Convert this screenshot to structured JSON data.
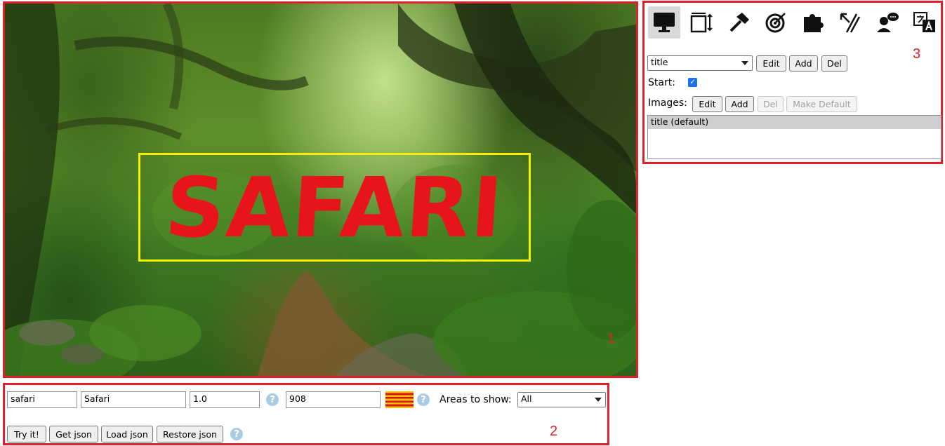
{
  "scene": {
    "title_text": "SAFARI",
    "area_number": "1"
  },
  "toolbar_bottom": {
    "id_value": "safari",
    "name_value": "Safari",
    "version_value": "1.0",
    "width_value": "908",
    "help_icon": "?",
    "areas_label": "Areas to show:",
    "areas_selected": "All",
    "buttons": {
      "try": "Try it!",
      "get_json": "Get json",
      "load_json": "Load json",
      "restore_json": "Restore json"
    },
    "area_number": "2",
    "flag_colors": [
      "#f5c400",
      "#d8141c"
    ]
  },
  "side_panel": {
    "tool_icons": [
      "monitor-icon",
      "resize-icon",
      "hammer-icon",
      "target-icon",
      "puzzle-icon",
      "cursor-lines-icon",
      "user-speech-icon",
      "translate-icon"
    ],
    "scene_selected": "title",
    "scene_buttons": {
      "edit": "Edit",
      "add": "Add",
      "del": "Del"
    },
    "start_label": "Start:",
    "start_checked": true,
    "start_check_glyph": "✓",
    "images_label": "Images:",
    "image_buttons": {
      "edit": "Edit",
      "add": "Add",
      "del": "Del",
      "make_default": "Make Default"
    },
    "image_list": [
      "title (default)"
    ],
    "area_number": "3"
  },
  "colors": {
    "annotation_red": "#e0202a",
    "title_red": "#e8141c",
    "title_box_yellow": "#f5f000"
  }
}
